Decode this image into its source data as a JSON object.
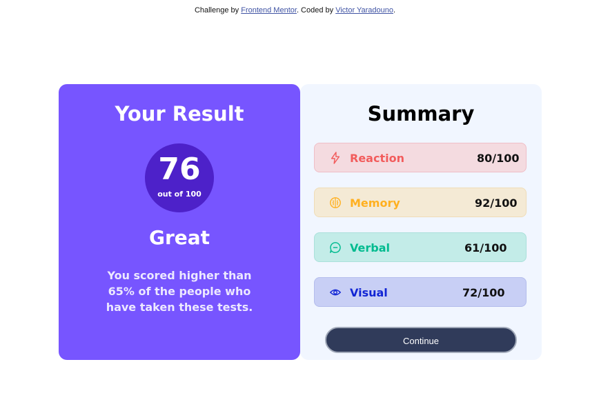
{
  "attribution": {
    "prefix": "Challenge by ",
    "link1": "Frontend Mentor",
    "middle": ". Coded by ",
    "link2": "Victor Yaradouno",
    "suffix": "."
  },
  "result": {
    "title": "Your Result",
    "score": "76",
    "score_max": "out of 100",
    "grade": "Great",
    "description": "You scored higher than 65% of the people who have taken these tests.",
    "background_color": "#7755ff"
  },
  "summary": {
    "title": "Summary",
    "items": [
      {
        "icon": "lightning-icon",
        "label": "Reaction",
        "value": "80/100",
        "color": "#f25c5c"
      },
      {
        "icon": "brain-icon",
        "label": "Memory",
        "value": "92/100",
        "color": "#ffb020"
      },
      {
        "icon": "chat-bubble-icon",
        "label": "Verbal",
        "value": "61/100",
        "color": "#00bb8f"
      },
      {
        "icon": "eye-icon",
        "label": "Visual",
        "value": "72/100",
        "color": "#1125d4"
      }
    ],
    "continue_label": "Continue"
  }
}
